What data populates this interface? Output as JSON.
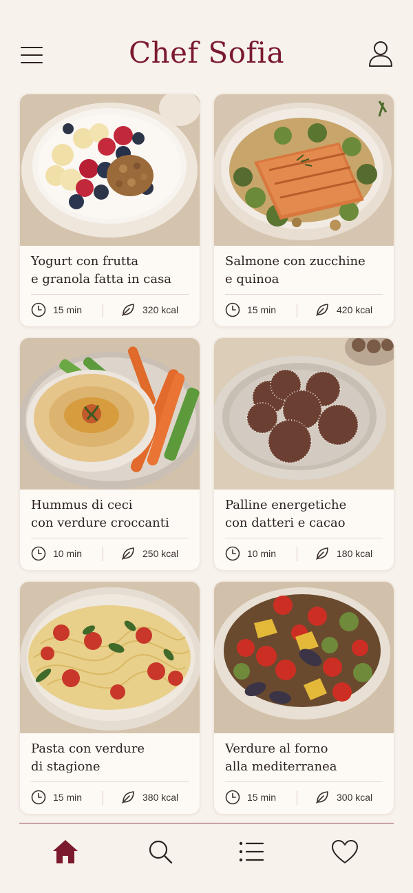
{
  "app": {
    "title": "Chef Sofia"
  },
  "colors": {
    "brand": "#7b1a2e",
    "background": "#f8f2ec",
    "card": "#fdf9f5"
  },
  "icons": {
    "menu": "hamburger-menu-icon",
    "profile": "user-profile-icon",
    "time": "clock-icon",
    "calories": "leaf-icon",
    "tabs": [
      "home-icon",
      "search-icon",
      "list-icon",
      "heart-icon"
    ]
  },
  "recipes": [
    {
      "line1": "Yogurt con frutta",
      "line2": "e granola fatta in casa",
      "time": "15 min",
      "kcal": "320 kcal",
      "image": "yogurt-bowl"
    },
    {
      "line1": "Salmone con zucchine",
      "line2": "e quinoa",
      "time": "15 min",
      "kcal": "420 kcal",
      "image": "salmon-plate"
    },
    {
      "line1": "Hummus di ceci",
      "line2": "con verdure croccanti",
      "time": "10 min",
      "kcal": "250 kcal",
      "image": "hummus-bowl"
    },
    {
      "line1": "Palline energetiche",
      "line2": "con datteri e cacao",
      "time": "10 min",
      "kcal": "180 kcal",
      "image": "energy-balls"
    },
    {
      "line1": "Pasta con verdure",
      "line2": "di stagione",
      "time": "15 min",
      "kcal": "380 kcal",
      "image": "pasta-plate"
    },
    {
      "line1": "Verdure al forno",
      "line2": "alla mediterranea",
      "time": "15 min",
      "kcal": "300 kcal",
      "image": "roasted-vegetables"
    }
  ],
  "tabbar": {
    "active": "home"
  }
}
